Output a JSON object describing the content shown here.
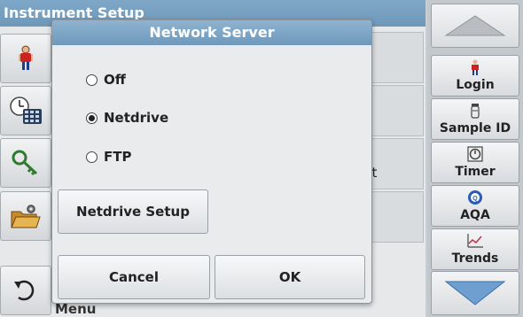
{
  "background": {
    "screen_title": "Instrument Setup",
    "partial_cell_text": "nt",
    "partial_bottom_text": "Menu",
    "left_icons": [
      "operator-icon",
      "clock-keypad-icon",
      "key-icon",
      "folder-gear-icon",
      "back-arrow-icon"
    ]
  },
  "toolbar": {
    "items": [
      {
        "label": "Login",
        "icon": "operator-icon"
      },
      {
        "label": "Sample ID",
        "icon": "sample-vial-icon"
      },
      {
        "label": "Timer",
        "icon": "timer-icon"
      },
      {
        "label": "AQA",
        "icon": "aqa-icon"
      },
      {
        "label": "Trends",
        "icon": "trends-chart-icon"
      }
    ]
  },
  "dialog": {
    "title": "Network Server",
    "options": [
      {
        "label": "Off",
        "selected": false
      },
      {
        "label": "Netdrive",
        "selected": true
      },
      {
        "label": "FTP",
        "selected": false
      }
    ],
    "setup_button": "Netdrive Setup",
    "cancel_button": "Cancel",
    "ok_button": "OK"
  },
  "colors": {
    "title_bar": "#7fa7c7",
    "dialog_title": "#6e98ba",
    "button_face": "#e9ebed",
    "toolbar_bg": "#c3c8cd"
  }
}
